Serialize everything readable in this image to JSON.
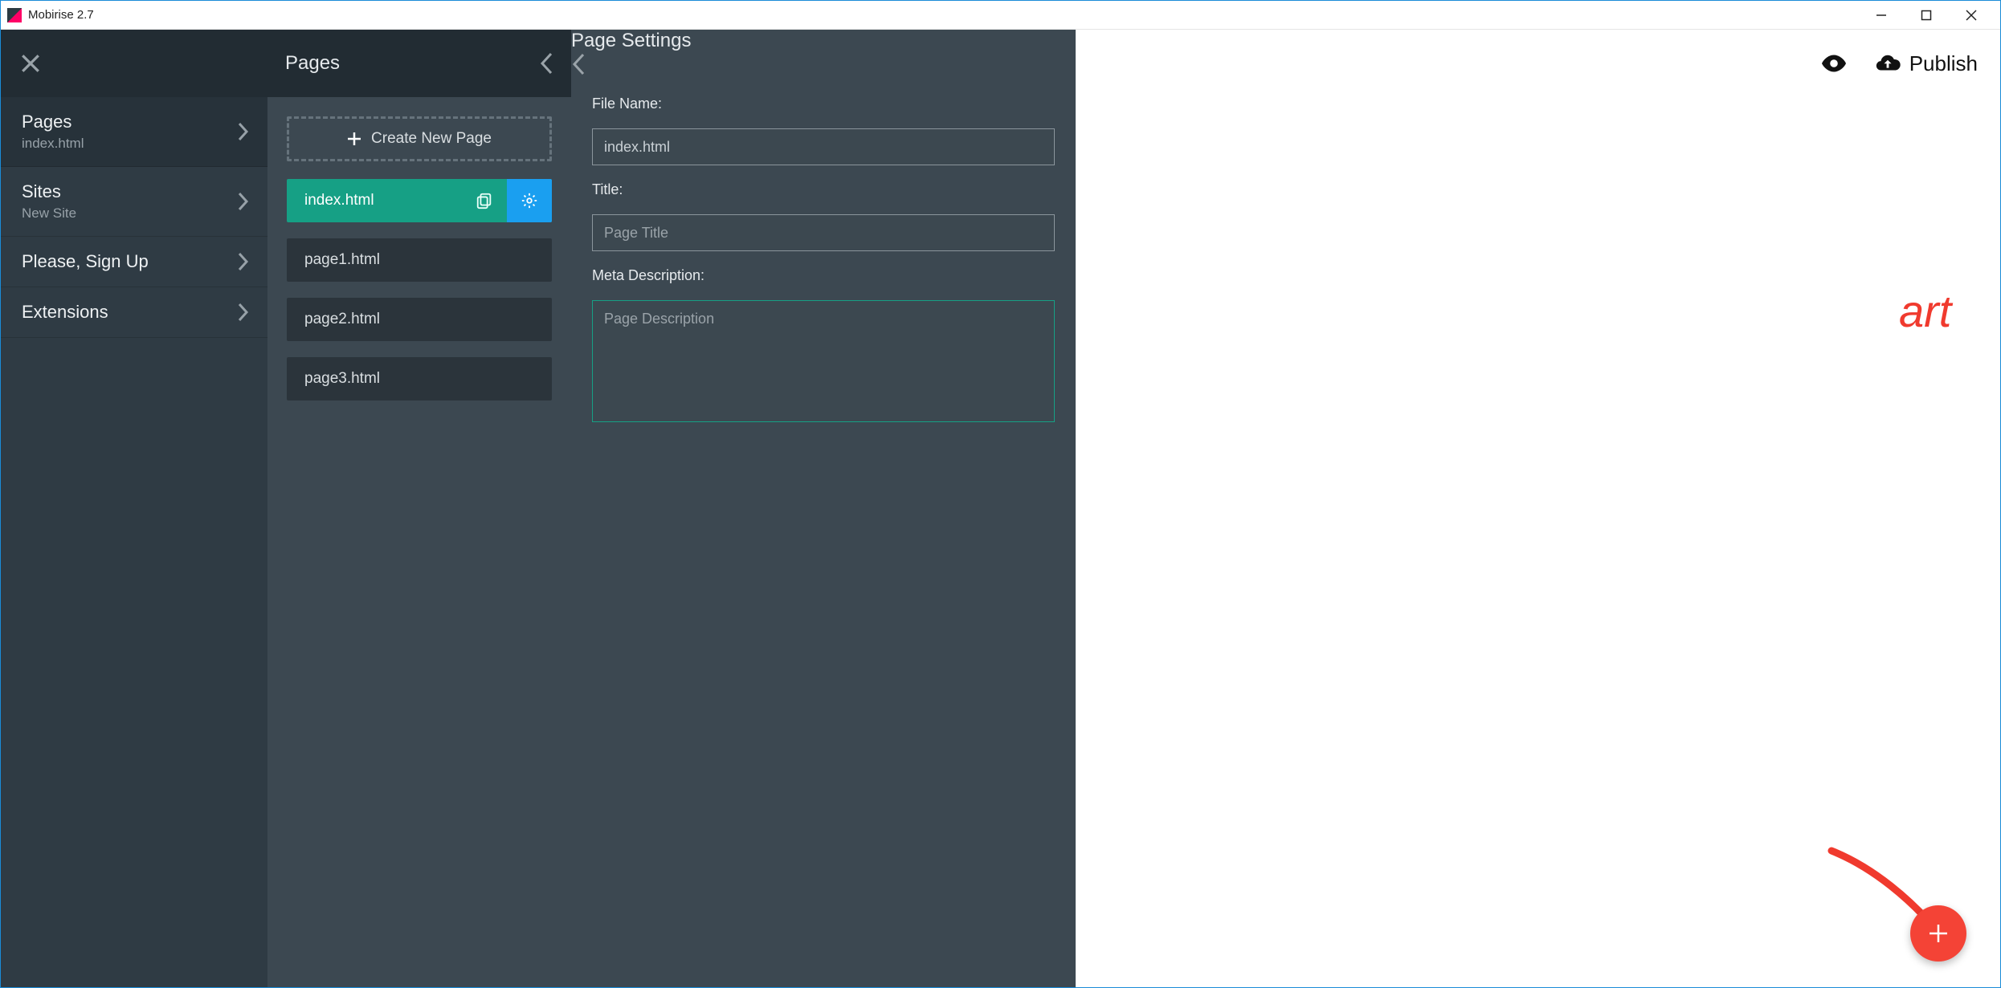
{
  "window": {
    "title": "Mobirise 2.7"
  },
  "topbar": {
    "publish_label": "Publish"
  },
  "sidebar": {
    "items": [
      {
        "label": "Pages",
        "sub": "index.html",
        "has_sub": true,
        "active": true
      },
      {
        "label": "Sites",
        "sub": "New Site",
        "has_sub": true,
        "active": false
      },
      {
        "label": "Please, Sign Up",
        "sub": "",
        "has_sub": false,
        "active": false
      },
      {
        "label": "Extensions",
        "sub": "",
        "has_sub": false,
        "active": false
      }
    ]
  },
  "pages_panel": {
    "title": "Pages",
    "create_label": "Create New Page",
    "items": [
      {
        "name": "index.html",
        "active": true
      },
      {
        "name": "page1.html",
        "active": false
      },
      {
        "name": "page2.html",
        "active": false
      },
      {
        "name": "page3.html",
        "active": false
      }
    ]
  },
  "settings_panel": {
    "title": "Page Settings",
    "file_name_label": "File Name:",
    "file_name_value": "index.html",
    "title_label": "Title:",
    "title_placeholder": "Page Title",
    "title_value": "",
    "meta_label": "Meta Description:",
    "meta_placeholder": "Page Description",
    "meta_value": ""
  },
  "annotations": {
    "text_fragment": "art"
  }
}
